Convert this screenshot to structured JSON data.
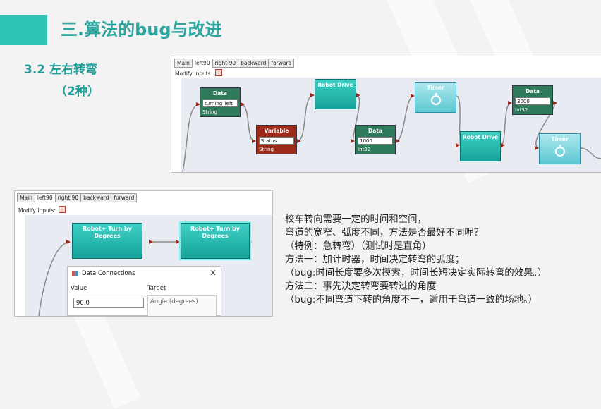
{
  "slide": {
    "title": "三.算法的bug与改进",
    "subtitle_line1": "3.2  左右转弯",
    "subtitle_line2": "（2种）"
  },
  "top_panel": {
    "tabs": [
      "Main",
      "left90",
      "right 90",
      "backward",
      "forward"
    ],
    "active_tab": "left90",
    "modify_inputs": "Modify Inputs:",
    "nodes": {
      "data1": {
        "title": "Data",
        "value": "turning_left",
        "type": "String"
      },
      "variable": {
        "title": "Variable",
        "value": "Status",
        "type": "String"
      },
      "robot_drive1": {
        "title": "Robot Drive"
      },
      "data2": {
        "title": "Data",
        "value": "1000",
        "type": "Int32"
      },
      "timer1": {
        "title": "Timer"
      },
      "robot_drive2": {
        "title": "Robot Drive"
      },
      "data3": {
        "title": "Data",
        "value": "3000",
        "type": "Int32"
      },
      "timer2": {
        "title": "Timer"
      }
    }
  },
  "bottom_panel": {
    "tabs": [
      "Main",
      "left90",
      "right 90",
      "backward",
      "forward"
    ],
    "active_tab": "left90",
    "modify_inputs": "Modify Inputs:",
    "nodes": {
      "turn1": {
        "title": "Robot+ Turn by Degrees"
      },
      "turn2": {
        "title": "Robot+ Turn by Degrees"
      }
    },
    "dialog": {
      "title": "Data Connections",
      "close": "✕",
      "value_label": "Value",
      "target_label": "Target",
      "value": "90.0",
      "target": "Angle (degrees)"
    }
  },
  "body_text": [
    "校车转向需要一定的时间和空间，",
    "弯道的宽窄、弧度不同，方法是否最好不同呢？",
    "（特例：急转弯）（测试时是直角）",
    "方法一：加计时器，时间决定转弯的弧度；",
    "（bug:时间长度要多次摸索，时间长短决定实际转弯的效果。）",
    "方法二：事先决定转弯要转过的角度",
    "（bug:不同弯道下转的角度不一，适用于弯道一致的场地。）"
  ],
  "colors": {
    "accent": "#2ec4b6",
    "title": "#2aa7a0"
  }
}
